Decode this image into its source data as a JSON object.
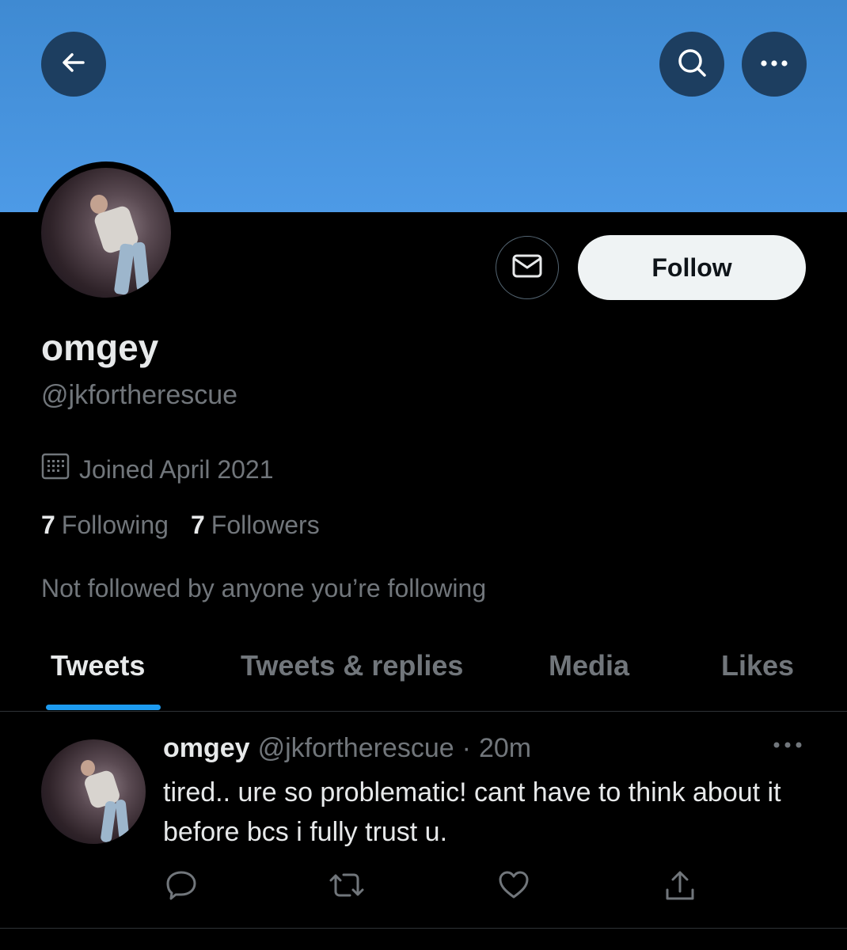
{
  "header": {
    "back_icon": "arrow-left-icon",
    "search_icon": "search-icon",
    "more_icon": "more-horizontal-icon",
    "banner_color": "#4a95de"
  },
  "profile": {
    "display_name": "omgey",
    "handle": "@jkfortherescue",
    "joined": "Joined April 2021",
    "following_count": "7",
    "following_label": "Following",
    "followers_count": "7",
    "followers_label": "Followers",
    "mutuals_note": "Not followed by anyone you’re following",
    "follow_label": "Follow",
    "message_icon": "envelope-icon",
    "calendar_icon": "calendar-icon"
  },
  "tabs": [
    {
      "label": "Tweets",
      "active": true
    },
    {
      "label": "Tweets & replies",
      "active": false
    },
    {
      "label": "Media",
      "active": false
    },
    {
      "label": "Likes",
      "active": false
    }
  ],
  "tweets": [
    {
      "name": "omgey",
      "handle": "@jkfortherescue",
      "separator": "·",
      "time": "20m",
      "text": "tired.. ure so problematic! cant have to think about it before bcs i fully trust u.",
      "actions": [
        "reply-icon",
        "retweet-icon",
        "like-icon",
        "share-icon"
      ]
    }
  ],
  "colors": {
    "accent": "#1d9bf0",
    "secondary_text": "#71767b",
    "follow_button_bg": "#eff3f4"
  }
}
